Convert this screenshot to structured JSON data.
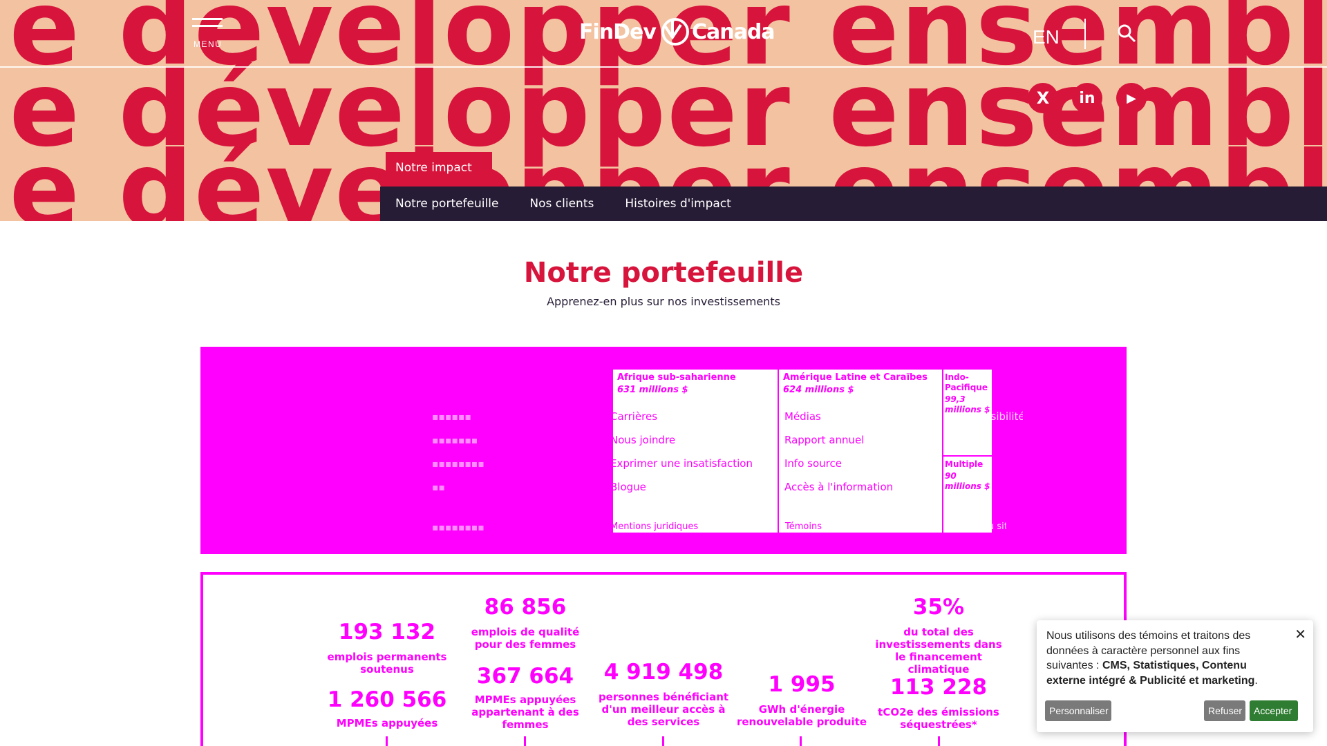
{
  "hero": {
    "pattern_text": "le développer ensemble développer ensemble",
    "menu_label": "MENU",
    "logo_left": "FinDev",
    "logo_right": "Canada",
    "lang": "EN",
    "colors": {
      "background": "#f3c2a1",
      "pattern": "#d7143b"
    }
  },
  "social": [
    {
      "name": "x-twitter-icon",
      "glyph": "X"
    },
    {
      "name": "linkedin-icon",
      "glyph": "in"
    },
    {
      "name": "youtube-icon",
      "glyph": "▶"
    }
  ],
  "nav": {
    "active_tab": "Notre impact",
    "items": [
      "Notre portefeuille",
      "Nos clients",
      "Histoires d'impact"
    ]
  },
  "page": {
    "title": "Notre portefeuille",
    "subtitle": "Apprenez-en plus sur nos investissements"
  },
  "treemap": [
    {
      "region": "Afrique sub-saharienne",
      "amount": "631 millions $"
    },
    {
      "region": "Amérique Latine et Caraïbes",
      "amount": "624 millions $"
    },
    {
      "region": "Indo-Pacifique",
      "amount": "99,3 millions $"
    },
    {
      "region": "Multiple",
      "amount": "90 millions $"
    }
  ],
  "footer_links": {
    "col1": [
      "Carrières",
      "Nous joindre",
      "Exprimer une insatisfaction",
      "Blogue"
    ],
    "col2": [
      "Médias",
      "Rapport annuel",
      "Info source",
      "Accès à l'information"
    ],
    "col3": [
      "Accessibilité"
    ],
    "legal": [
      "Mentions juridiques",
      "Témoins",
      "Plan du site"
    ]
  },
  "stats": [
    {
      "num": "193 132",
      "label": "emplois permanents soutenus"
    },
    {
      "num": "1 260 566",
      "label": "MPMEs appuyées"
    },
    {
      "num": "86 856",
      "label": "emplois de qualité pour des femmes"
    },
    {
      "num": "367 664",
      "label": "MPMEs appuyées appartenant à des femmes"
    },
    {
      "num": "4 919 498",
      "label": "personnes bénéficiant d'un meilleur accès à des services"
    },
    {
      "num": "1 995",
      "label": "GWh d'énergie renouvelable produite"
    },
    {
      "num": "35%",
      "label": "du total des investissements dans le financement climatique"
    },
    {
      "num": "113 228",
      "label": "tCO2e des émissions séquestrées*"
    }
  ],
  "cookie": {
    "text": "Nous utilisons des témoins et traitons des données à caractère personnel aux fins suivantes : ",
    "strong": "CMS, Statistiques, Contenu externe intégré & Publicité et marketing",
    "end": ".",
    "buttons": {
      "customize": "Personnaliser",
      "refuse": "Refuser",
      "accept": "Accepter"
    }
  }
}
